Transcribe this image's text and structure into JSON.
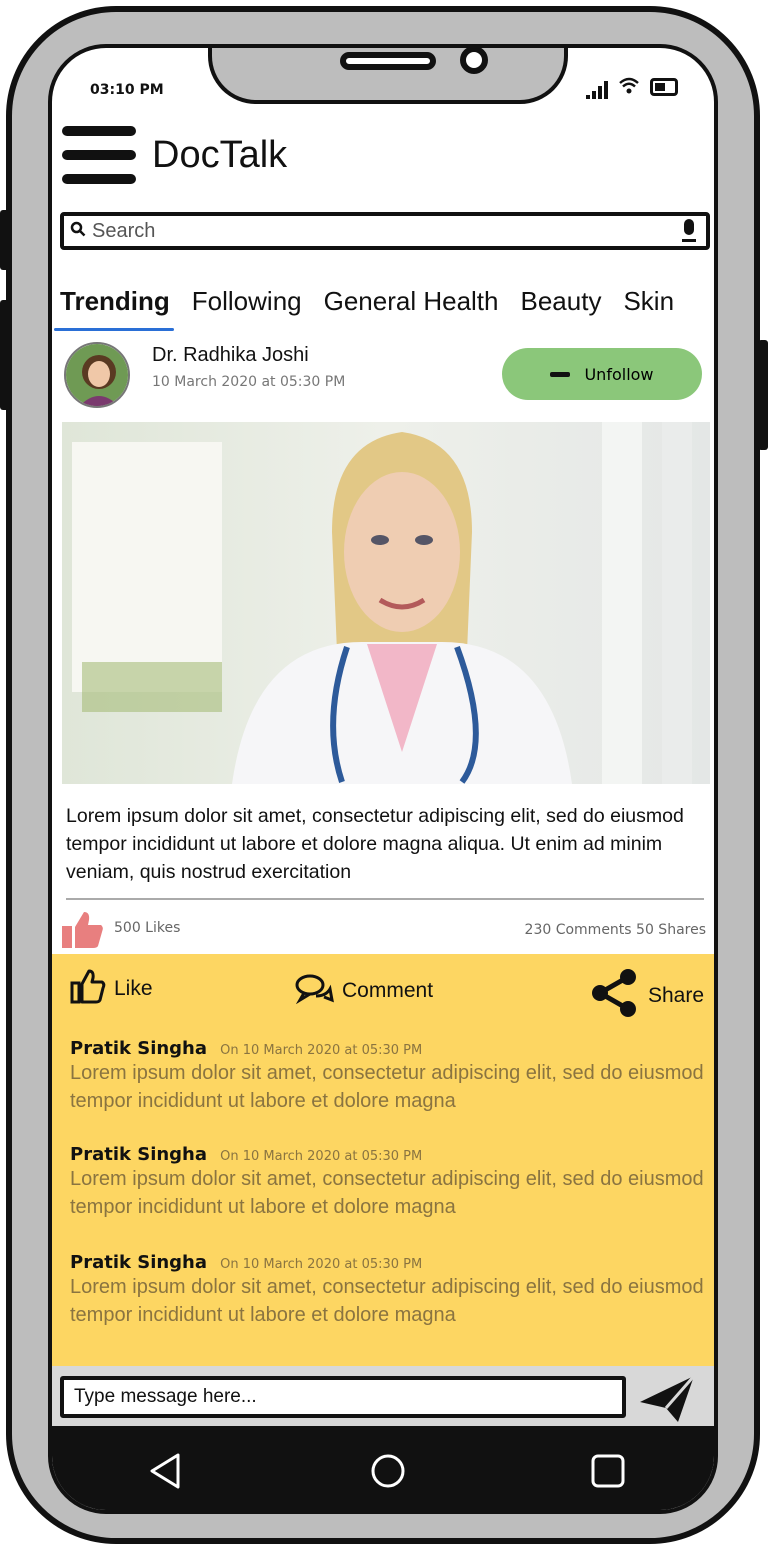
{
  "status_bar": {
    "time": "03:10 PM"
  },
  "app": {
    "title": "DocTalk"
  },
  "search": {
    "placeholder": "Search"
  },
  "tabs": [
    {
      "label": "Trending",
      "active": true
    },
    {
      "label": "Following"
    },
    {
      "label": "General Health"
    },
    {
      "label": "Beauty"
    },
    {
      "label": "Skin"
    }
  ],
  "post": {
    "author": "Dr. Radhika Joshi",
    "date": "10 March 2020 at 05:30 PM",
    "follow_button": "Unfollow",
    "text": "Lorem ipsum dolor sit amet, consectetur adipiscing elit, sed do eiusmod tempor incididunt ut labore et dolore magna aliqua. Ut enim ad minim veniam, quis nostrud exercitation",
    "likes": "500 Likes",
    "comments_shares": "230 Comments  50 Shares"
  },
  "actions": {
    "like": "Like",
    "comment": "Comment",
    "share": "Share"
  },
  "comments": [
    {
      "name": "Pratik Singha",
      "date": "On 10 March 2020 at 05:30 PM",
      "text": "Lorem ipsum dolor sit amet, consectetur adipiscing elit, sed do eiusmod tempor incididunt ut labore et dolore magna"
    },
    {
      "name": "Pratik Singha",
      "date": "On 10 March 2020 at 05:30 PM",
      "text": "Lorem ipsum dolor sit amet, consectetur adipiscing elit, sed do eiusmod tempor incididunt ut labore et dolore magna"
    },
    {
      "name": "Pratik Singha",
      "date": "On 10 March 2020 at 05:30 PM",
      "text": "Lorem ipsum dolor sit amet, consectetur adipiscing elit, sed do eiusmod tempor incididunt ut labore et dolore magna"
    }
  ],
  "message": {
    "placeholder": "Type message here..."
  },
  "colors": {
    "accent_green": "#8bc77a",
    "comments_bg": "#fdd662",
    "like_pink": "#e87f7f",
    "tab_underline": "#2a6fd6"
  }
}
